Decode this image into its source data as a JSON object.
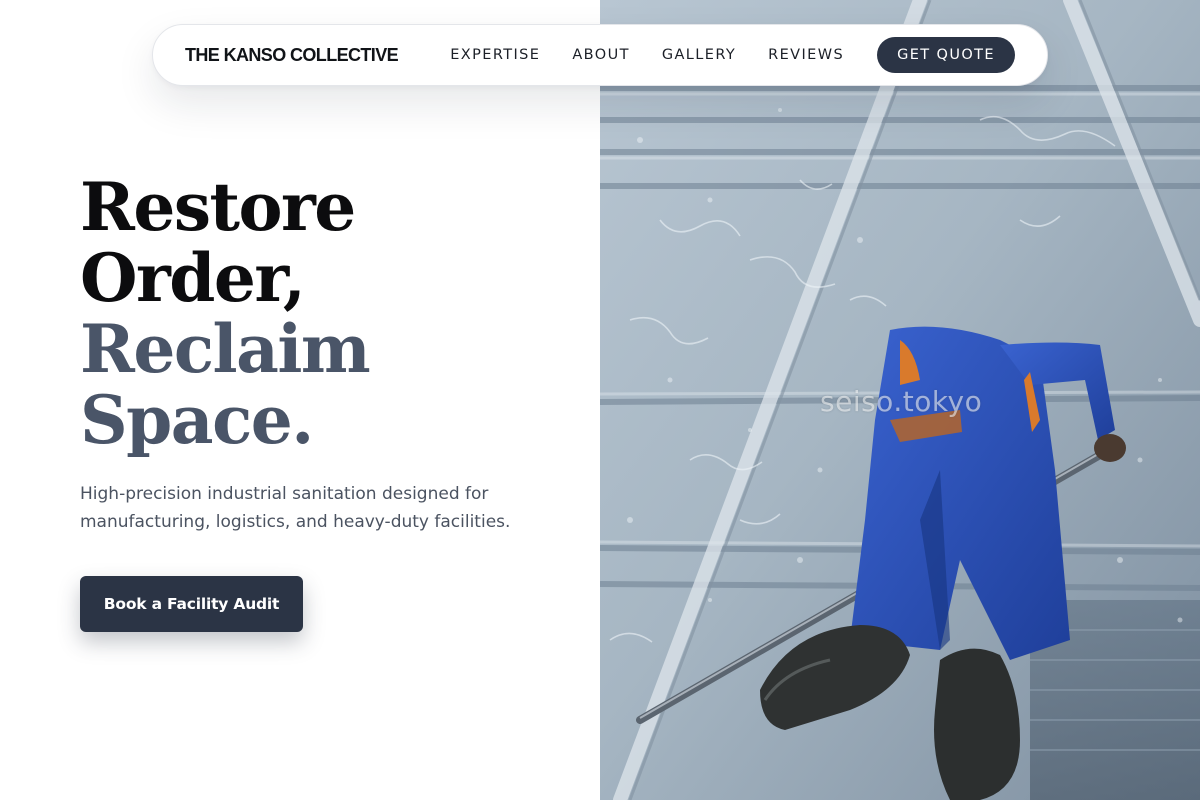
{
  "brand": {
    "name": "THE KANSO COLLECTIVE"
  },
  "nav": {
    "links": [
      {
        "label": "EXPERTISE"
      },
      {
        "label": "ABOUT"
      },
      {
        "label": "GALLERY"
      },
      {
        "label": "REVIEWS"
      }
    ],
    "cta_label": "GET QUOTE"
  },
  "hero": {
    "headline": {
      "line1": "Restore",
      "line2": "Order,",
      "line3": "Reclaim",
      "line4": "Space."
    },
    "subtext": "High-precision industrial sanitation designed for manufacturing, logistics, and heavy-duty facilities.",
    "cta_label": "Book a Facility Audit",
    "photo_watermark": "seiso.tokyo"
  },
  "colors": {
    "primary": "#2b3445",
    "accent_text": "#4a5568",
    "heading": "#0c0c0e",
    "body_text": "#4b5361",
    "overalls_blue": "#2a4fb8"
  },
  "icons": {
    "photo_subject": "window-cleaner-on-glass-photo"
  }
}
